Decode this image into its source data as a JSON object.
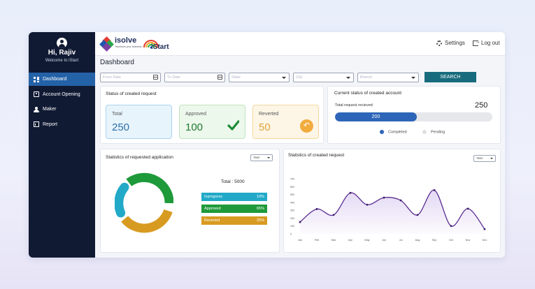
{
  "sidebar": {
    "greeting": "Hi, Rajiv",
    "welcome": "Welcome to iStart",
    "items": [
      {
        "label": "Dashboard",
        "icon": "dashboard-icon",
        "active": true
      },
      {
        "label": "Account Opening",
        "icon": "id-card-icon",
        "active": false
      },
      {
        "label": "Maker",
        "icon": "user-hand-icon",
        "active": false
      },
      {
        "label": "Report",
        "icon": "report-icon",
        "active": false
      }
    ]
  },
  "header": {
    "brand1": "isolve",
    "brand1_tagline": "Transform your business",
    "brand2": "iStart",
    "settings_label": "Settings",
    "logout_label": "Log out"
  },
  "page": {
    "title": "Dashboard"
  },
  "filters": {
    "from_date": "From Date",
    "to_date": "To Date",
    "state": "State",
    "city": "City",
    "branch": "Branch",
    "search_label": "SEARCH"
  },
  "created_request": {
    "title": "Status of created request",
    "total_label": "Total",
    "total_value": "250",
    "approved_label": "Approved",
    "approved_value": "100",
    "reverted_label": "Reverted",
    "reverted_value": "50"
  },
  "account_status": {
    "title": "Current status of created account",
    "received_label": "Total request recieved",
    "received_value": "250",
    "progress_value": "200",
    "progress_fraction": 0.52,
    "legend_completed": "Completed",
    "legend_pending": "Pending"
  },
  "requested_application": {
    "title": "Statistics of requested application",
    "year_select": "Year",
    "total_label": "Total : 5000",
    "breakdown": [
      {
        "label": "Inprogress",
        "value": "10%",
        "color": "#22a9c8"
      },
      {
        "label": "Approved",
        "value": "65%",
        "color": "#1f9a3a"
      },
      {
        "label": "Reverted",
        "value": "25%",
        "color": "#d89b21"
      }
    ]
  },
  "created_stats": {
    "title": "Statistics of created request",
    "year_select": "Year"
  },
  "colors": {
    "sidebar_bg": "#111a33",
    "active_nav": "#2462a8",
    "accent_teal": "#176b7c",
    "line_purple": "#5a2d91"
  },
  "chart_data": {
    "type": "area",
    "categories": [
      "Jan",
      "Feb",
      "Mar",
      "Apr",
      "May",
      "Jun",
      "Jul",
      "Aug",
      "Sep",
      "Oct",
      "Nov",
      "Dec"
    ],
    "y_ticks": [
      "700",
      "600",
      "500",
      "400",
      "300",
      "200",
      "100",
      "0"
    ],
    "ylim": [
      0,
      700
    ],
    "series": [
      {
        "values": [
          150,
          315,
          240,
          520,
          370,
          460,
          425,
          240,
          555,
          100,
          320,
          60
        ]
      }
    ],
    "grid": false
  }
}
